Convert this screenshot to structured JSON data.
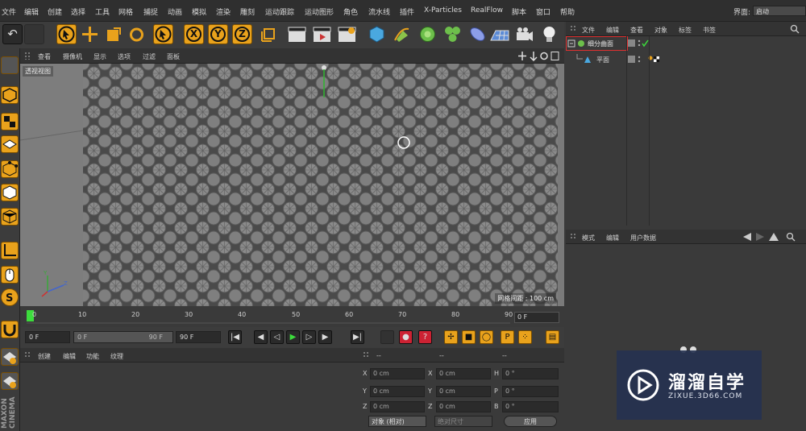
{
  "menubar": {
    "items": [
      "文件",
      "编辑",
      "创建",
      "选择",
      "工具",
      "网格",
      "捕捉",
      "动画",
      "模拟",
      "渲染",
      "雕刻",
      "运动跟踪",
      "运动图形",
      "角色",
      "流水线",
      "插件",
      "X-Particles",
      "RealFlow",
      "脚本",
      "窗口",
      "帮助"
    ],
    "interface_label": "界面:",
    "interface_value": "启动"
  },
  "viewport": {
    "menu": [
      "查看",
      "摄像机",
      "显示",
      "选项",
      "过滤",
      "面板"
    ],
    "label": "透视视图",
    "grid_label": "网格间距 : 100 cm"
  },
  "timeline": {
    "ticks": [
      "0",
      "10",
      "20",
      "30",
      "40",
      "50",
      "60",
      "70",
      "80",
      "90"
    ],
    "current_frame": "0 F"
  },
  "transport": {
    "start": "0 F",
    "range_start": "0 F",
    "range_end": "90 F",
    "end": "90 F"
  },
  "material_panel": {
    "menu": [
      "创建",
      "编辑",
      "功能",
      "纹理"
    ]
  },
  "coordinates": {
    "header": [
      "--",
      "--",
      "--"
    ],
    "rows": [
      {
        "a": "X",
        "av": "0 cm",
        "b": "X",
        "bv": "0 cm",
        "c": "H",
        "cv": "0 °"
      },
      {
        "a": "Y",
        "av": "0 cm",
        "b": "Y",
        "bv": "0 cm",
        "c": "P",
        "cv": "0 °"
      },
      {
        "a": "Z",
        "av": "0 cm",
        "b": "Z",
        "bv": "0 cm",
        "c": "B",
        "cv": "0 °"
      }
    ],
    "mode": "对象 (相对)",
    "size_mode": "绝对尺寸",
    "apply": "应用"
  },
  "object_manager": {
    "menu": [
      "文件",
      "编辑",
      "查看",
      "对象",
      "标签",
      "书签"
    ],
    "objects": [
      {
        "name": "细分曲面",
        "selected": true
      },
      {
        "name": "平面",
        "selected": false
      }
    ]
  },
  "attribute_manager": {
    "menu": [
      "模式",
      "编辑",
      "用户数据"
    ]
  },
  "watermark": {
    "title": "溜溜自学",
    "subtitle": "ZIXUE.3D66.COM"
  },
  "colors": {
    "accent": "#e9a21c",
    "selection_box": "#e03030",
    "panel_bg": "#3a3a3a",
    "watermark_bg": "#263250"
  }
}
